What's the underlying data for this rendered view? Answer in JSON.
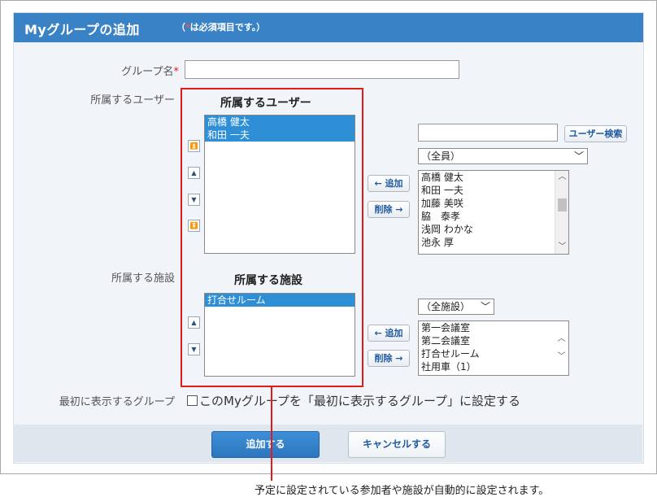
{
  "header": {
    "title": "Myグループの追加",
    "note_prefix": "（",
    "note_star": "*",
    "note_suffix": "は必須項目です。）"
  },
  "form": {
    "group_name_label": "グループ名",
    "required_mark": "*",
    "group_name_value": "",
    "members_label": "所属するユーザー",
    "facilities_label": "所属する施設",
    "first_display_label": "最初に表示するグループ",
    "first_display_checkbox": "このMyグループを「最初に表示するグループ」に設定する"
  },
  "users_section": {
    "title": "所属するユーザー",
    "selected": [
      "高橋 健太",
      "和田 一夫"
    ]
  },
  "facilities_section": {
    "title": "所属する施設",
    "selected": [
      "打合せルーム"
    ]
  },
  "user_search": {
    "query": "",
    "search_button": "ユーザー検索",
    "group_select": "（全員）",
    "add_button": "← 追加",
    "remove_button": "削除 →",
    "candidates": [
      "高橋 健太",
      "和田 一夫",
      "加藤 美咲",
      "脇　泰孝",
      "浅岡 わかな",
      "池永 厚"
    ]
  },
  "facility_search": {
    "group_select": "（全施設）",
    "add_button": "← 追加",
    "remove_button": "削除 →",
    "candidates": [
      "第一会議室",
      "第二会議室",
      "打合せルーム",
      "社用車（1）"
    ]
  },
  "actions": {
    "submit": "追加する",
    "cancel": "キャンセルする"
  },
  "callout": "予定に設定されている参加者や施設が自動的に設定されます。",
  "colors": {
    "header": "#3a82c6",
    "highlight": "#e21a1a",
    "selected": "#2f8fd6"
  }
}
